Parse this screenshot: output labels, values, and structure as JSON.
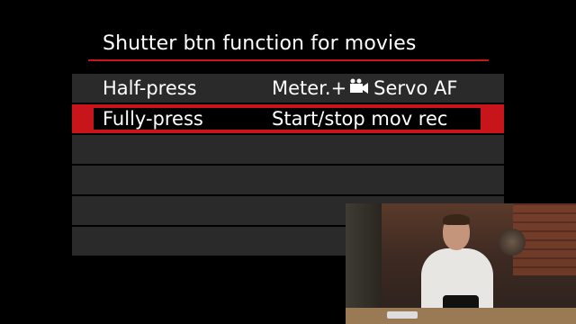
{
  "menu": {
    "title": "Shutter btn function for movies",
    "rows": [
      {
        "label": "Half-press",
        "value_prefix": "Meter.+",
        "value_suffix": "Servo AF",
        "icon": "movie-camera-icon",
        "selected": false
      },
      {
        "label": "Fully-press",
        "value": "Start/stop mov rec",
        "selected": true
      },
      {
        "label": "",
        "value": ""
      },
      {
        "label": "",
        "value": ""
      },
      {
        "label": "",
        "value": ""
      },
      {
        "label": "",
        "value": ""
      }
    ]
  },
  "colors": {
    "accent_red": "#c8141b",
    "row_bg": "#2a2a2a",
    "background": "#000000",
    "text": "#ffffff"
  }
}
